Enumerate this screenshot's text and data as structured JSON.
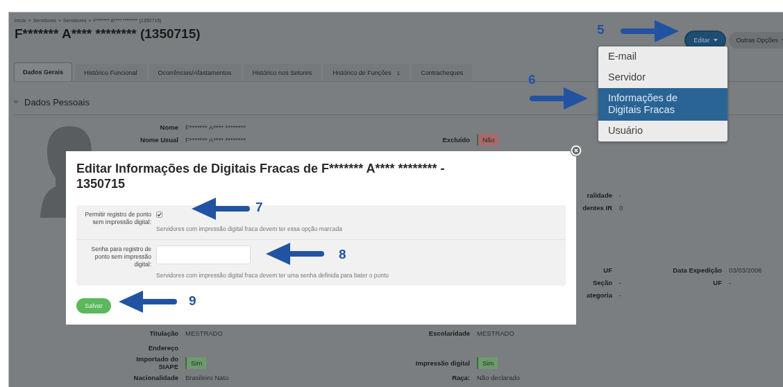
{
  "breadcrumb": {
    "separator": "»",
    "items": [
      "Início",
      "Servidores",
      "Servidores",
      "F******* A**** ******** (1350715)"
    ]
  },
  "title": "F******* A**** ******** (1350715)",
  "actions": [
    {
      "label": "Editar",
      "kind": "primary",
      "expanded": true
    },
    {
      "label": "Outras Opções",
      "kind": "secondary",
      "expanded": false
    }
  ],
  "tabs": [
    {
      "label": "Dados Gerais",
      "selected": true
    },
    {
      "label": "Histórico Funcional",
      "selected": false
    },
    {
      "label": "Ocorrências/Afastamentos",
      "selected": false
    },
    {
      "label": "Histórico nos Setores",
      "selected": false
    },
    {
      "label": "Histórico de Funções",
      "selected": false,
      "count": "1"
    },
    {
      "label": "Contracheques",
      "selected": false
    }
  ],
  "section": {
    "title": "Dados Pessoais",
    "expanded": true
  },
  "upper_rows": [
    {
      "column_1": {
        "label": "Nome",
        "value": "F******* A**** ********"
      }
    },
    {
      "column_1": {
        "label": "Nome Usual",
        "value": "F******* A**** ********"
      },
      "column_2": {
        "label": "Excluído",
        "value": "Não",
        "color": "#a86a6a"
      }
    },
    {
      "column_3": {
        "label": "ralidade",
        "value": "-"
      }
    },
    {
      "column_3": {
        "label": "dentes IR",
        "value": "0"
      }
    },
    {
      "column_3": {
        "label": "UF"
      },
      "column_4": {
        "label": "Data Expedição",
        "value": "03/03/2006"
      }
    },
    {
      "column_3": {
        "label": "Seção",
        "value": "-"
      },
      "column_4": {
        "label": "UF",
        "value": "-"
      }
    },
    {
      "column_3": {
        "label": "ategoria",
        "value": "-"
      }
    }
  ],
  "lower_rows": [
    {
      "column_1": {
        "label": "Titulação",
        "value": "MESTRADO"
      },
      "column_2": {
        "label": "Escolaridade",
        "value": "MESTRADO"
      }
    },
    {
      "column_1": {
        "label": "Endereço"
      }
    },
    {
      "column_1": {
        "label": "Importado do SIAPE",
        "value": "Sim",
        "color": "#6d9a6d"
      },
      "column_2": {
        "label": "Impressão digital",
        "value": "Sim",
        "color": "#6d9a6d"
      }
    },
    {
      "column_1": {
        "label": "Nacionalidade",
        "value": "Brasileiro Nato"
      },
      "column_2": {
        "label": "Raça:",
        "value": "Não declarado"
      }
    }
  ],
  "menu": [
    {
      "label": "E-mail",
      "selected": false
    },
    {
      "label": "Servidor",
      "selected": false
    },
    {
      "label": "Informações de Digitais Fracas",
      "selected": true
    },
    {
      "label": "Usuário",
      "selected": false
    }
  ],
  "modal": {
    "title": "Editar Informações de Digitais Fracas de F******* A**** ******** - 1350715",
    "fields": [
      {
        "kind": "checkbox",
        "label": "Permitir registro de ponto sem impressão digital:",
        "checked": true,
        "help": "Servidores com impressão digital fraca devem ter essa opção marcada"
      },
      {
        "kind": "text_input",
        "label": "Senha para registro de ponto sem impressão digital:",
        "help": "Servidores com impressão digital fraca devem ter uma senha definida para bater o ponto"
      }
    ],
    "submit": "Salvar"
  },
  "annotations": [
    {
      "number": "5",
      "kind": "right_arrow"
    },
    {
      "number": "6",
      "kind": "right_arrow"
    },
    {
      "number": "7",
      "kind": "left_arrow"
    },
    {
      "number": "8",
      "kind": "left_arrow"
    },
    {
      "number": "9",
      "kind": "left_arrow"
    }
  ]
}
